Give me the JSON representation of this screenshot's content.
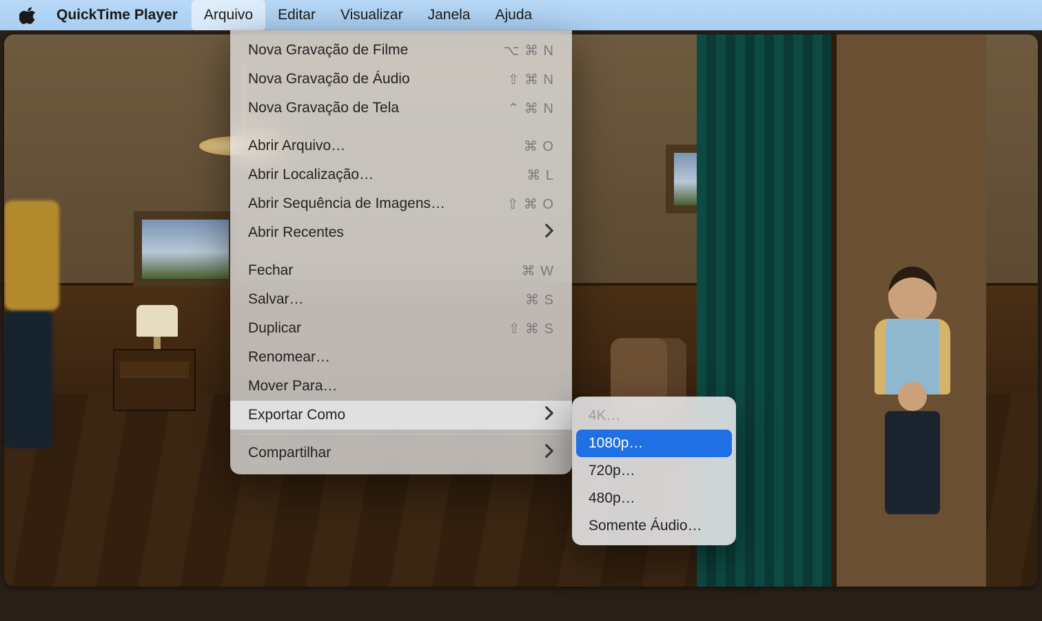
{
  "menubar": {
    "app_name": "QuickTime Player",
    "items": [
      "Arquivo",
      "Editar",
      "Visualizar",
      "Janela",
      "Ajuda"
    ],
    "active_index": 0
  },
  "file_menu": {
    "groups": [
      [
        {
          "label": "Nova Gravação de Filme",
          "shortcut": "⌥ ⌘ N",
          "submenu": false
        },
        {
          "label": "Nova Gravação de Áudio",
          "shortcut": "⇧ ⌘ N",
          "submenu": false
        },
        {
          "label": "Nova Gravação de Tela",
          "shortcut": "⌃ ⌘ N",
          "submenu": false
        }
      ],
      [
        {
          "label": "Abrir Arquivo…",
          "shortcut": "⌘ O",
          "submenu": false
        },
        {
          "label": "Abrir Localização…",
          "shortcut": "⌘ L",
          "submenu": false
        },
        {
          "label": "Abrir Sequência de Imagens…",
          "shortcut": "⇧ ⌘ O",
          "submenu": false
        },
        {
          "label": "Abrir Recentes",
          "shortcut": "",
          "submenu": true
        }
      ],
      [
        {
          "label": "Fechar",
          "shortcut": "⌘ W",
          "submenu": false
        },
        {
          "label": "Salvar…",
          "shortcut": "⌘ S",
          "submenu": false
        },
        {
          "label": "Duplicar",
          "shortcut": "⇧ ⌘ S",
          "submenu": false
        },
        {
          "label": "Renomear…",
          "shortcut": "",
          "submenu": false
        },
        {
          "label": "Mover Para…",
          "shortcut": "",
          "submenu": false
        },
        {
          "label": "Exportar Como",
          "shortcut": "",
          "submenu": true,
          "hover": true
        }
      ],
      [
        {
          "label": "Compartilhar",
          "shortcut": "",
          "submenu": true
        }
      ]
    ]
  },
  "export_submenu": {
    "items": [
      {
        "label": "4K…",
        "disabled": true,
        "selected": false
      },
      {
        "label": "1080p…",
        "disabled": false,
        "selected": true
      },
      {
        "label": "720p…",
        "disabled": false,
        "selected": false
      },
      {
        "label": "480p…",
        "disabled": false,
        "selected": false
      },
      {
        "label": "Somente Áudio…",
        "disabled": false,
        "selected": false
      }
    ]
  }
}
